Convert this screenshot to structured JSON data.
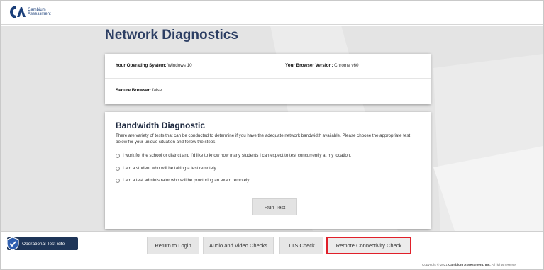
{
  "brand": {
    "name_line1": "Cambium",
    "name_line2": "Assessment",
    "colors": {
      "navy": "#1e3558",
      "highlight": "#e0202a",
      "background": "#e4e4e4"
    }
  },
  "page": {
    "title": "Network Diagnostics"
  },
  "system": {
    "os_label": "Your Operating System:",
    "os_value": " Windows 10",
    "browser_label": "Your Browser Version:",
    "browser_value": " Chrome v60",
    "secure_label": "Secure Browser:",
    "secure_value": " false"
  },
  "bandwidth": {
    "title": "Bandwidth Diagnostic",
    "description": "There are variety of tests that can be conducted to determine if you have the adequate network bandwidth available. Please choose the appropriate test below for your unique situation and follow the steps.",
    "options": [
      "I work for the school or district and I'd like to know how many students I can expect to test concurrently at my location.",
      "I am a student who will be taking a test remotely.",
      "I am a test administrator who will be proctoring an exam remotely."
    ],
    "run_label": "Run Test"
  },
  "footer": {
    "site_badge": "Operational Test Site",
    "buttons": [
      "Return to Login",
      "Audio and Video Checks",
      "TTS Check",
      "Remote Connectivity Check"
    ],
    "active_button": "Remote Connectivity Check",
    "copyright_prefix": "Copyright © 2021 ",
    "copyright_company": "Cambium Assessment, Inc.",
    "copyright_suffix": " All rights reserve"
  }
}
